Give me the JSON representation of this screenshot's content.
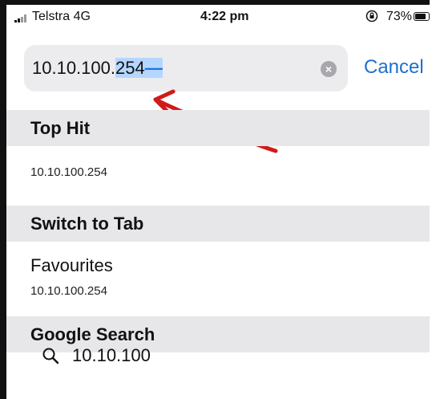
{
  "status_bar": {
    "carrier": "Telstra 4G",
    "time": "4:22 pm",
    "battery_percent": "73%"
  },
  "search_bar": {
    "value_plain": "10.10.100.",
    "value_selected": "254",
    "cursor_mark": "—",
    "clear_label": "×"
  },
  "cancel_label": "Cancel",
  "sections": {
    "top_hit": {
      "header": "Top Hit",
      "item": "10.10.100.254"
    },
    "switch_to_tab": {
      "header": "Switch to Tab",
      "item_title": "Favourites",
      "item_url": "10.10.100.254"
    },
    "google_search": {
      "header": "Google Search",
      "suggestion": "10.10.100"
    }
  },
  "annotation": {
    "arrow_color": "#d11a1a"
  }
}
